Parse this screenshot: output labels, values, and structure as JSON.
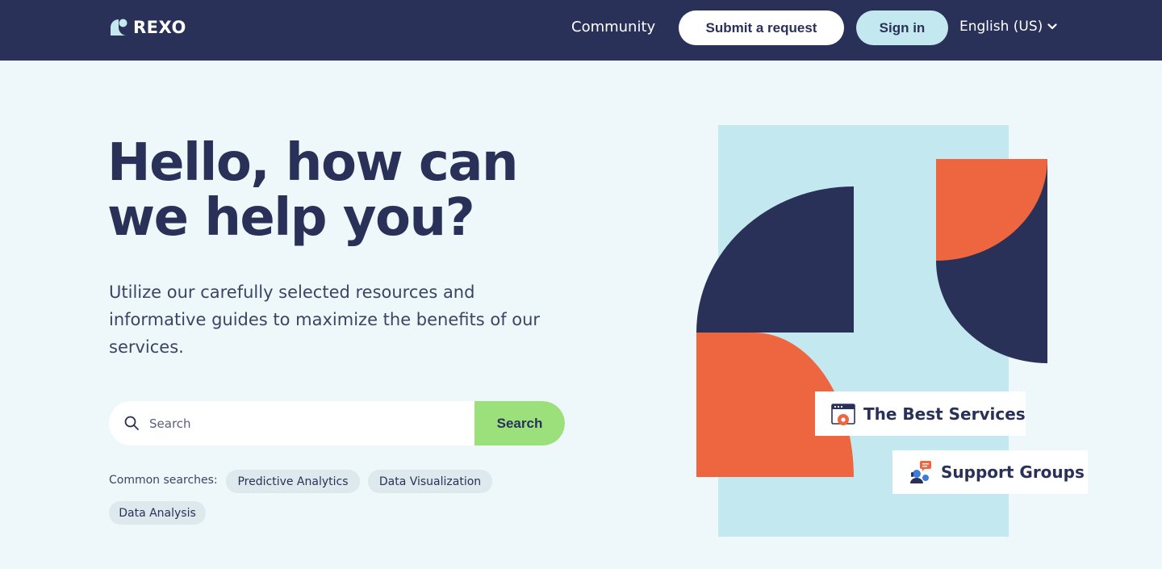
{
  "header": {
    "logo_text": "REXO",
    "nav_community": "Community",
    "submit_request": "Submit a request",
    "sign_in": "Sign in",
    "language": "English (US)"
  },
  "hero": {
    "title": "Hello, how can we help you?",
    "subtitle": "Utilize our carefully selected resources and informative guides to maximize the benefits of our services."
  },
  "search": {
    "placeholder": "Search",
    "button": "Search",
    "icon": "search-icon"
  },
  "common_searches": {
    "label": "Common searches:",
    "items": [
      "Predictive Analytics",
      "Data Visualization",
      "Data Analysis"
    ]
  },
  "cards": {
    "best_services": "The Best Services",
    "support_groups": "Support Groups"
  },
  "colors": {
    "navy": "#2a3159",
    "page_bg": "#eef8fa",
    "light_blue": "#c4e8ef",
    "orange": "#ee6640",
    "green": "#9be07b"
  }
}
